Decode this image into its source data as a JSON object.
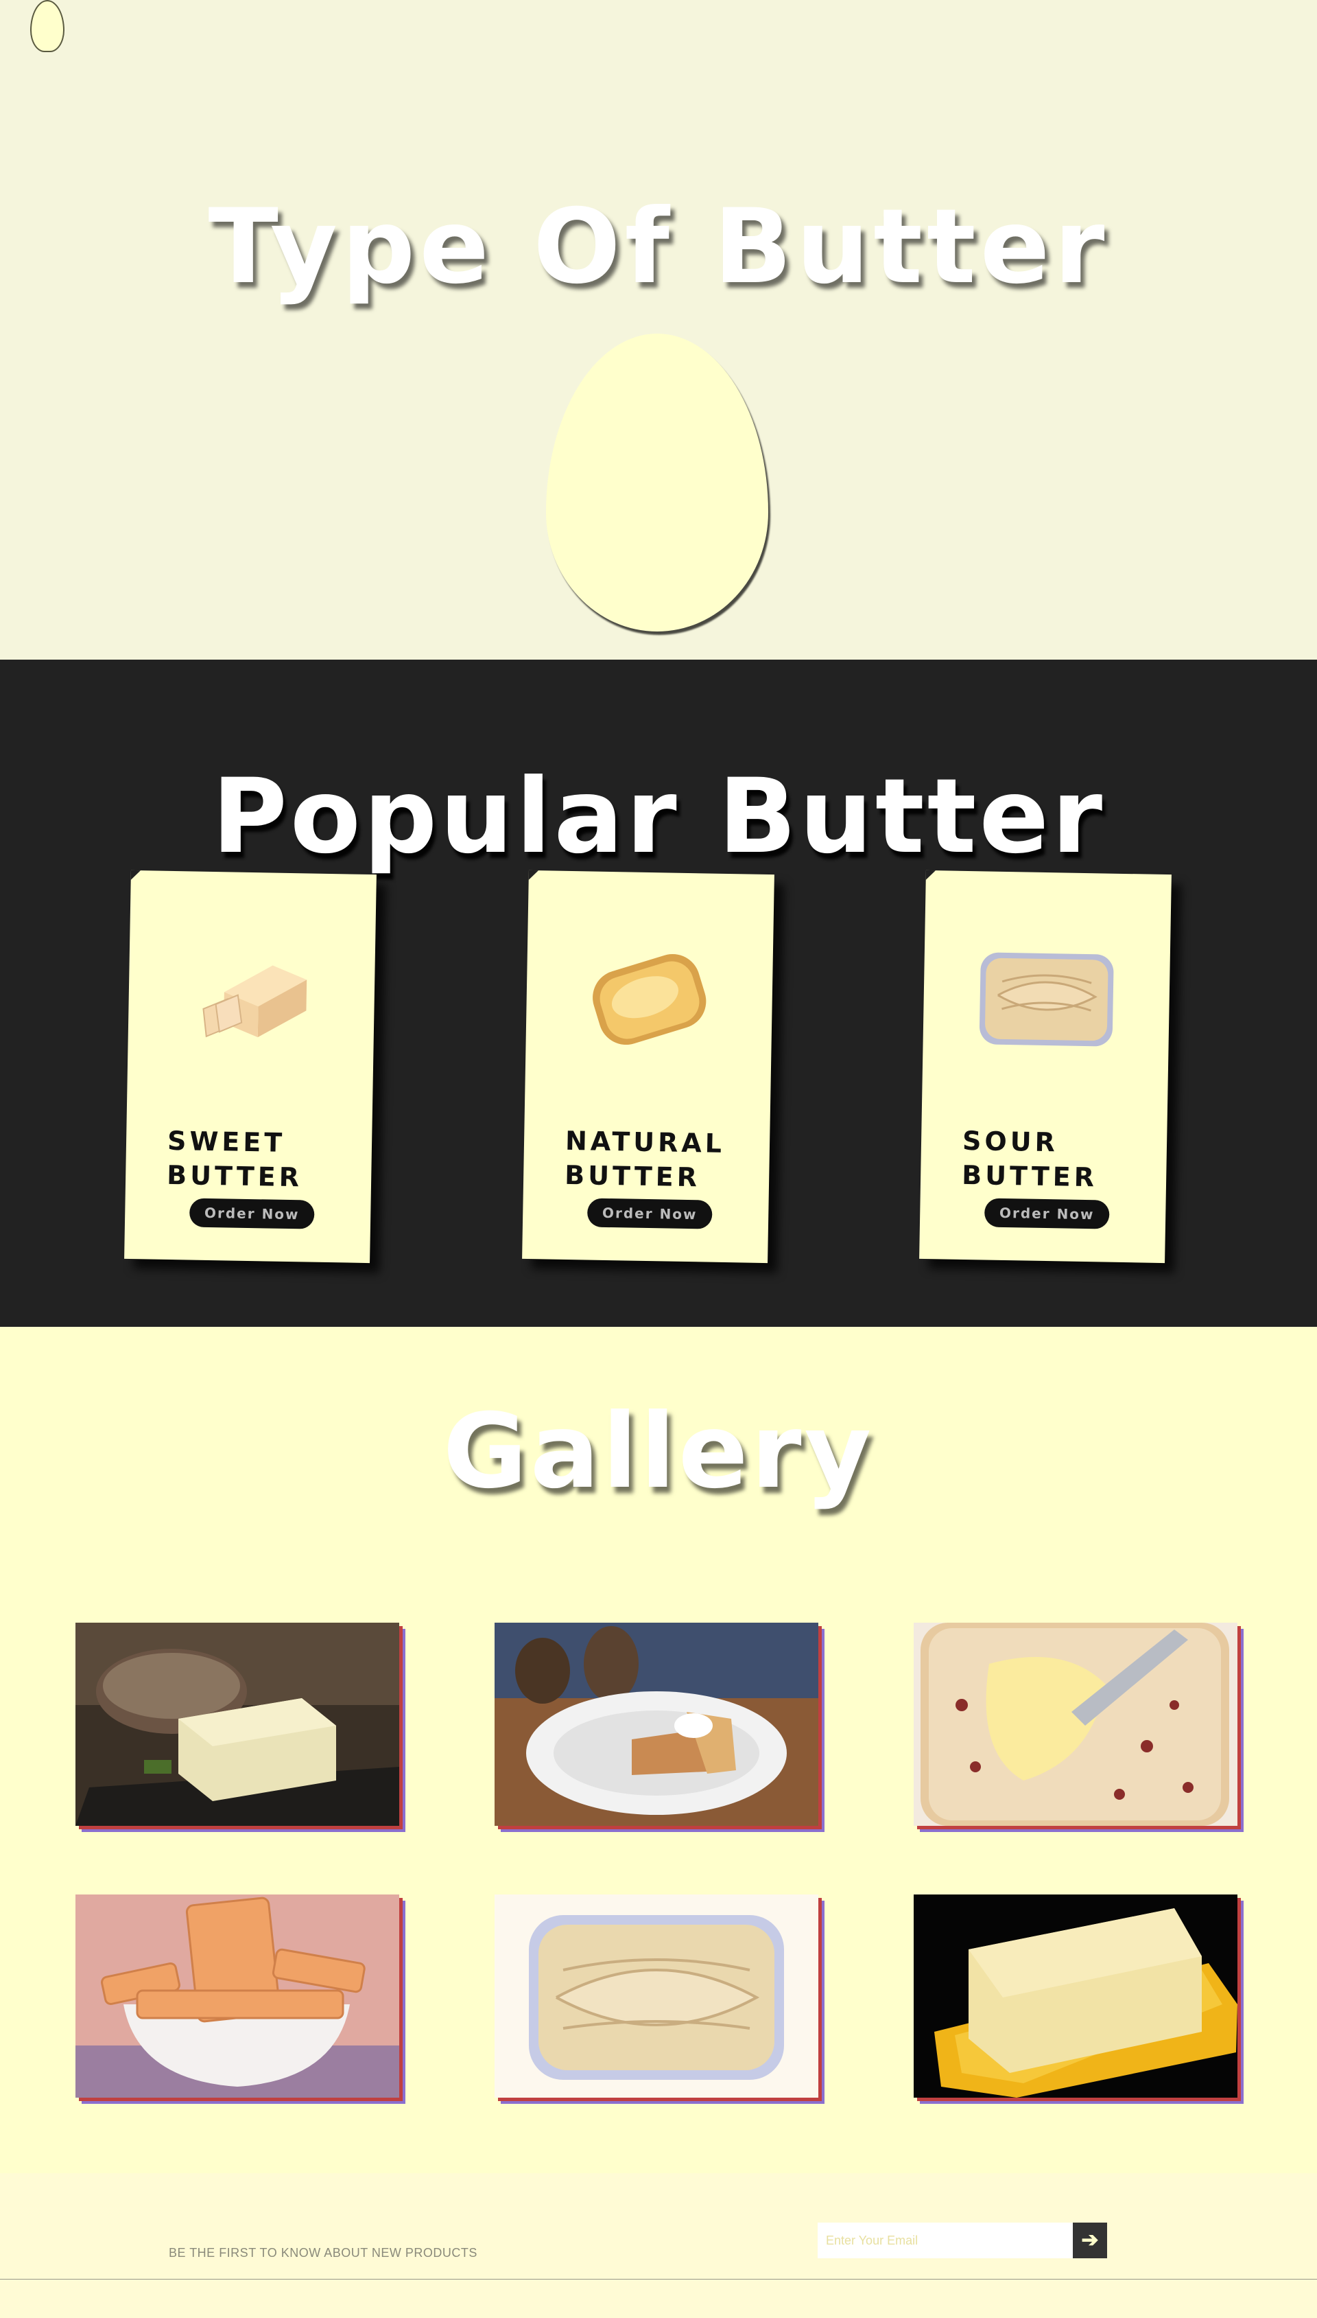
{
  "hero": {
    "title": "Type Of Butter"
  },
  "popular": {
    "title": "Popular Butter",
    "cards": [
      {
        "name": "SWEET BUTTER",
        "button": "Order Now"
      },
      {
        "name": "NATURAL BUTTER",
        "button": "Order Now"
      },
      {
        "name": "SOUR BUTTER",
        "button": "Order Now"
      }
    ]
  },
  "gallery": {
    "title": "Gallery",
    "images": [
      "butter-on-bread-board-image",
      "pumpkin-pie-image",
      "butter-on-raisin-bread-image",
      "biscuits-in-bowl-image",
      "butter-tub-image",
      "butter-dish-image"
    ]
  },
  "footer": {
    "subtitle": "BE THE FIRST TO KNOW ABOUT NEW PRODUCTS",
    "email_placeholder": "Enter Your Email",
    "submit_icon": "arrow-right-icon"
  },
  "colors": {
    "hero_bg": "#f5f5dc",
    "popular_bg": "#222222",
    "gallery_bg": "#ffffcc",
    "card_bg": "#ffffcc",
    "footer_bg": "#fffbd5"
  }
}
